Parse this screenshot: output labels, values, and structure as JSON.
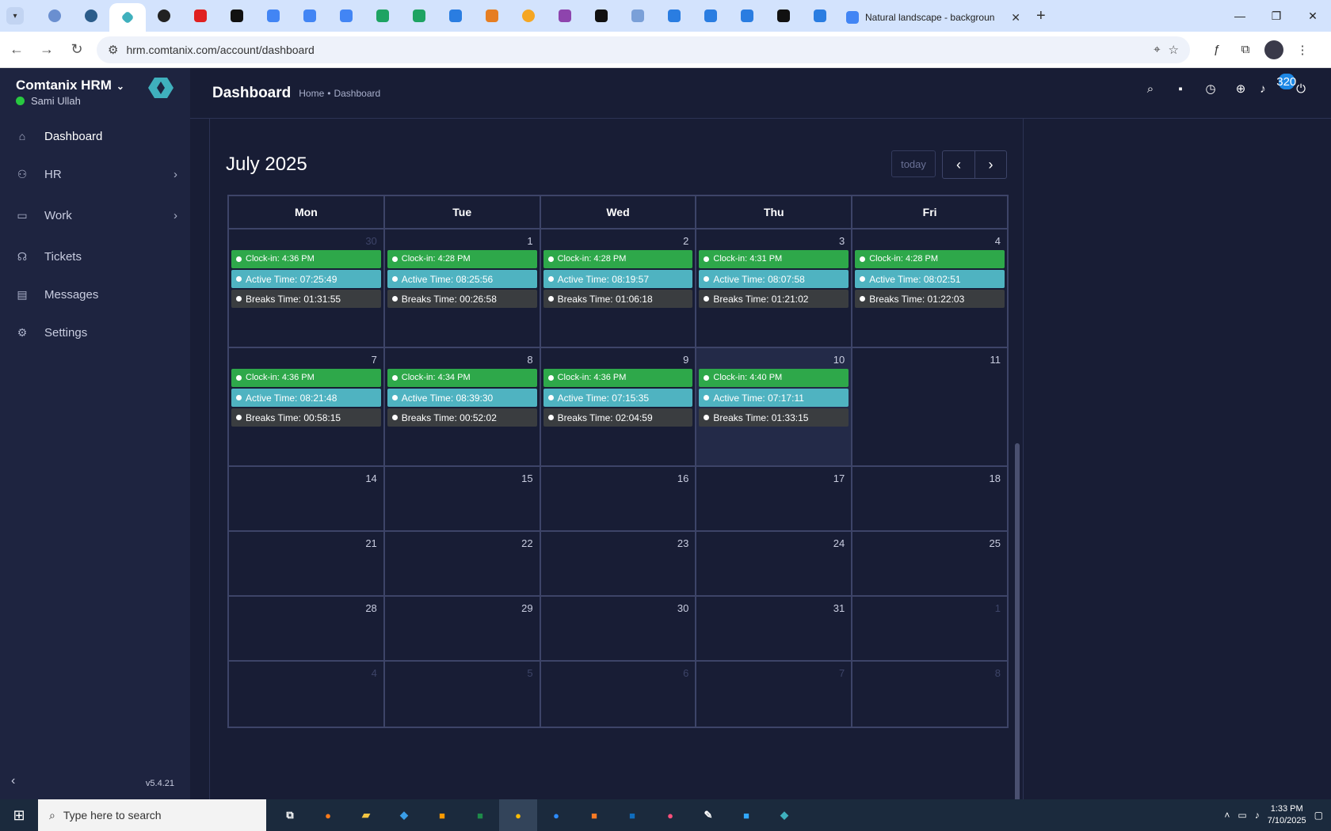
{
  "browser": {
    "active_tab_title": "Natural landscape - backgroun",
    "url": "hrm.comtanix.com/account/dashboard"
  },
  "app": {
    "brand": "Comtanix HRM",
    "user": "Sami Ullah",
    "version": "v5.4.21",
    "nav": [
      {
        "label": "Dashboard"
      },
      {
        "label": "HR"
      },
      {
        "label": "Work"
      },
      {
        "label": "Tickets"
      },
      {
        "label": "Messages"
      },
      {
        "label": "Settings"
      }
    ],
    "page_title": "Dashboard",
    "breadcrumb": [
      "Home",
      "•",
      "Dashboard"
    ],
    "notifications_count": "320"
  },
  "calendar": {
    "title": "July 2025",
    "today_label": "today",
    "weekdays": [
      "Mon",
      "Tue",
      "Wed",
      "Thu",
      "Fri"
    ],
    "weeks": [
      [
        {
          "date": "30",
          "muted": true,
          "clock": "Clock-in: 4:36 PM",
          "active": "Active Time: 07:25:49",
          "breaks": "Breaks Time: 01:31:55"
        },
        {
          "date": "1",
          "clock": "Clock-in: 4:28 PM",
          "active": "Active Time: 08:25:56",
          "breaks": "Breaks Time: 00:26:58"
        },
        {
          "date": "2",
          "clock": "Clock-in: 4:28 PM",
          "active": "Active Time: 08:19:57",
          "breaks": "Breaks Time: 01:06:18"
        },
        {
          "date": "3",
          "clock": "Clock-in: 4:31 PM",
          "active": "Active Time: 08:07:58",
          "breaks": "Breaks Time: 01:21:02"
        },
        {
          "date": "4",
          "clock": "Clock-in: 4:28 PM",
          "active": "Active Time: 08:02:51",
          "breaks": "Breaks Time: 01:22:03"
        }
      ],
      [
        {
          "date": "7",
          "clock": "Clock-in: 4:36 PM",
          "active": "Active Time: 08:21:48",
          "breaks": "Breaks Time: 00:58:15"
        },
        {
          "date": "8",
          "clock": "Clock-in: 4:34 PM",
          "active": "Active Time: 08:39:30",
          "breaks": "Breaks Time: 00:52:02"
        },
        {
          "date": "9",
          "clock": "Clock-in: 4:36 PM",
          "active": "Active Time: 07:15:35",
          "breaks": "Breaks Time: 02:04:59"
        },
        {
          "date": "10",
          "today": true,
          "clock": "Clock-in: 4:40 PM",
          "active": "Active Time: 07:17:11",
          "breaks": "Breaks Time: 01:33:15"
        },
        {
          "date": "11"
        }
      ],
      [
        {
          "date": "14"
        },
        {
          "date": "15"
        },
        {
          "date": "16"
        },
        {
          "date": "17"
        },
        {
          "date": "18"
        }
      ],
      [
        {
          "date": "21"
        },
        {
          "date": "22"
        },
        {
          "date": "23"
        },
        {
          "date": "24"
        },
        {
          "date": "25"
        }
      ],
      [
        {
          "date": "28"
        },
        {
          "date": "29"
        },
        {
          "date": "30"
        },
        {
          "date": "31"
        },
        {
          "date": "1",
          "muted": true
        }
      ],
      [
        {
          "date": "4",
          "muted": true
        },
        {
          "date": "5",
          "muted": true
        },
        {
          "date": "6",
          "muted": true
        },
        {
          "date": "7",
          "muted": true
        },
        {
          "date": "8",
          "muted": true
        }
      ]
    ]
  },
  "taskbar": {
    "search_placeholder": "Type here to search",
    "time": "1:33 PM",
    "date": "7/10/2025"
  },
  "colors": {
    "clock_in": "#2ea84a",
    "active_time": "#4fb3c1",
    "breaks_time": "#3a3d40",
    "app_bg": "#181d35",
    "sidebar_bg": "#1e2440"
  }
}
